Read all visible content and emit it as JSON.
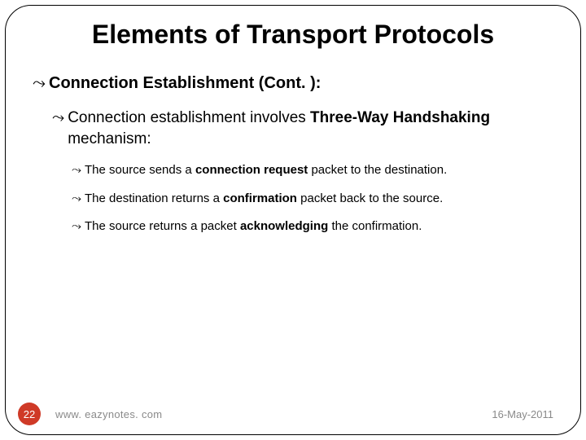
{
  "title": "Elements of Transport Protocols",
  "level1": {
    "text": "Connection Establishment (Cont. ):"
  },
  "level2": {
    "prefix": "Connection establishment involves ",
    "bold": "Three-Way Handshaking",
    "suffix": " mechanism:"
  },
  "bullets": [
    {
      "prefix": "The source sends a ",
      "bold": "connection request",
      "suffix": " packet to the destination."
    },
    {
      "prefix": "The destination returns a ",
      "bold": "confirmation",
      "suffix": " packet back to the source."
    },
    {
      "prefix": "The source returns a packet ",
      "bold": "acknowledging",
      "suffix": " the confirmation."
    }
  ],
  "footer": {
    "page": "22",
    "site": "www. eazynotes. com",
    "date": "16-May-2011"
  },
  "glyphs": {
    "curl": "⤳"
  }
}
